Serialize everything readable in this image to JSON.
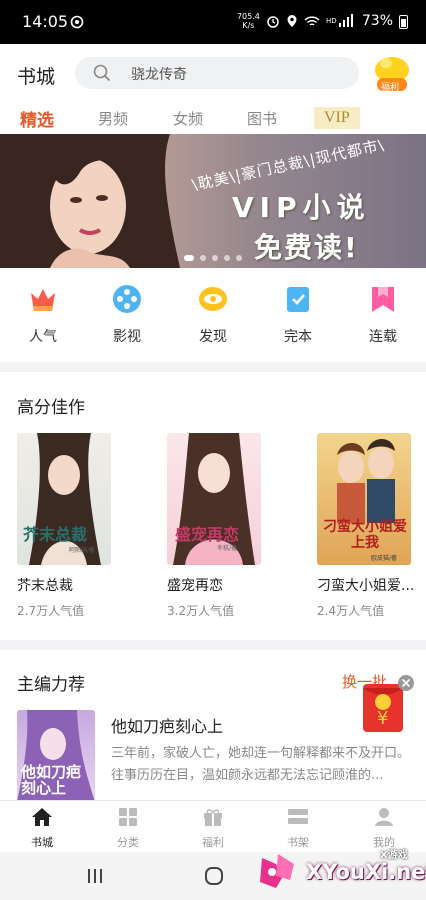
{
  "status": {
    "time": "14:05",
    "speed_value": "705.4",
    "speed_unit": "K/s",
    "battery": "73%"
  },
  "header": {
    "title": "书城",
    "search_placeholder": "骁龙传奇",
    "gift_label": "福利"
  },
  "tabs": [
    {
      "label": "精选"
    },
    {
      "label": "男频"
    },
    {
      "label": "女频"
    },
    {
      "label": "图书"
    },
    {
      "label": "VIP"
    }
  ],
  "banner": {
    "genres": "\\耽美\\|豪门总裁\\|现代都市\\",
    "line1": "VIP小说",
    "line2": "免费读!"
  },
  "categories": [
    {
      "label": "人气",
      "icon": "crown-icon"
    },
    {
      "label": "影视",
      "icon": "film-reel-icon"
    },
    {
      "label": "发现",
      "icon": "eye-icon"
    },
    {
      "label": "完本",
      "icon": "book-check-icon"
    },
    {
      "label": "连载",
      "icon": "bookmark-icon"
    }
  ],
  "high_score": {
    "title": "高分佳作",
    "books": [
      {
        "title": "芥末总裁",
        "popularity": "2.7万人气值",
        "cover_text": "芥末总裁",
        "cover_author": "阿陌萌/著"
      },
      {
        "title": "盛宠再恋",
        "popularity": "3.2万人气值",
        "cover_text": "盛宠再恋",
        "cover_author": "冬糕/著"
      },
      {
        "title": "刁蛮大小姐爱...",
        "popularity": "2.4万人气值",
        "cover_text": "刁蛮大小姐爱上我",
        "cover_author": "欧皮猫/著"
      }
    ]
  },
  "editor_pick": {
    "title": "主编力荐",
    "more": "换一批",
    "book": {
      "title": "他如刀疤刻心上",
      "desc": "三年前，家破人亡，她却连一句解释都来不及开口。往事历历在目，温如颜永远都无法忘记顾淮的...",
      "cover_text": "他如刀疤刻心上"
    }
  },
  "bottom_nav": [
    {
      "label": "书城",
      "icon": "home-icon"
    },
    {
      "label": "分类",
      "icon": "grid-icon"
    },
    {
      "label": "福利",
      "icon": "gift-icon"
    },
    {
      "label": "书架",
      "icon": "bookshelf-icon"
    },
    {
      "label": "我的",
      "icon": "user-icon"
    }
  ],
  "watermark": {
    "text": "XYouXi.net",
    "small": "X游戏"
  },
  "colors": {
    "accent": "#e45a2b",
    "vip_bg": "#f8ecc4"
  }
}
